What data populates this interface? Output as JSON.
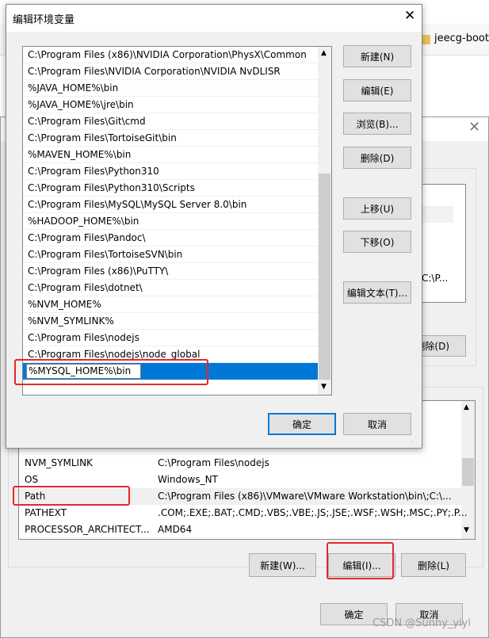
{
  "background_window": {
    "tab_label": "jeecg-boot"
  },
  "env_dialog": {
    "user_vars_partial_value": "C:\\P...",
    "user_delete_label": "删除(D)",
    "system_vars": [
      {
        "name": "NVM_SYMLINK",
        "value": "C:\\Program Files\\nodejs"
      },
      {
        "name": "OS",
        "value": "Windows_NT"
      },
      {
        "name": "Path",
        "value": "C:\\Program Files (x86)\\VMware\\VMware Workstation\\bin\\;C:\\..."
      },
      {
        "name": "PATHEXT",
        "value": ".COM;.EXE;.BAT;.CMD;.VBS;.VBE;.JS;.JSE;.WSF;.WSH;.MSC;.PY;.P..."
      },
      {
        "name": "PROCESSOR_ARCHITECT...",
        "value": "AMD64"
      }
    ],
    "new_label": "新建(W)...",
    "edit_label": "编辑(I)...",
    "delete_label": "删除(L)",
    "ok_label": "确定",
    "cancel_label": "取消"
  },
  "edit_dialog": {
    "title": "编辑环境变量",
    "paths": [
      "C:\\Program Files (x86)\\NVIDIA Corporation\\PhysX\\Common",
      "C:\\Program Files\\NVIDIA Corporation\\NVIDIA NvDLISR",
      "%JAVA_HOME%\\bin",
      "%JAVA_HOME%\\jre\\bin",
      "C:\\Program Files\\Git\\cmd",
      "C:\\Program Files\\TortoiseGit\\bin",
      "%MAVEN_HOME%\\bin",
      "C:\\Program Files\\Python310",
      "C:\\Program Files\\Python310\\Scripts",
      "C:\\Program Files\\MySQL\\MySQL Server 8.0\\bin",
      "%HADOOP_HOME%\\bin",
      "C:\\Program Files\\Pandoc\\",
      "C:\\Program Files\\TortoiseSVN\\bin",
      "C:\\Program Files (x86)\\PuTTY\\",
      "C:\\Program Files\\dotnet\\",
      "%NVM_HOME%",
      "%NVM_SYMLINK%",
      "C:\\Program Files\\nodejs",
      "C:\\Program Files\\nodejs\\node_global"
    ],
    "editing_value": "%MYSQL_HOME%\\bin",
    "buttons": {
      "new": "新建(N)",
      "edit": "编辑(E)",
      "browse": "浏览(B)...",
      "delete": "删除(D)",
      "move_up": "上移(U)",
      "move_down": "下移(O)",
      "edit_text": "编辑文本(T)...",
      "ok": "确定",
      "cancel": "取消"
    }
  },
  "watermark": "CSDN @Sunny_yiyi",
  "colors": {
    "selection": "#0078d7",
    "highlight_box": "#e8262a"
  }
}
